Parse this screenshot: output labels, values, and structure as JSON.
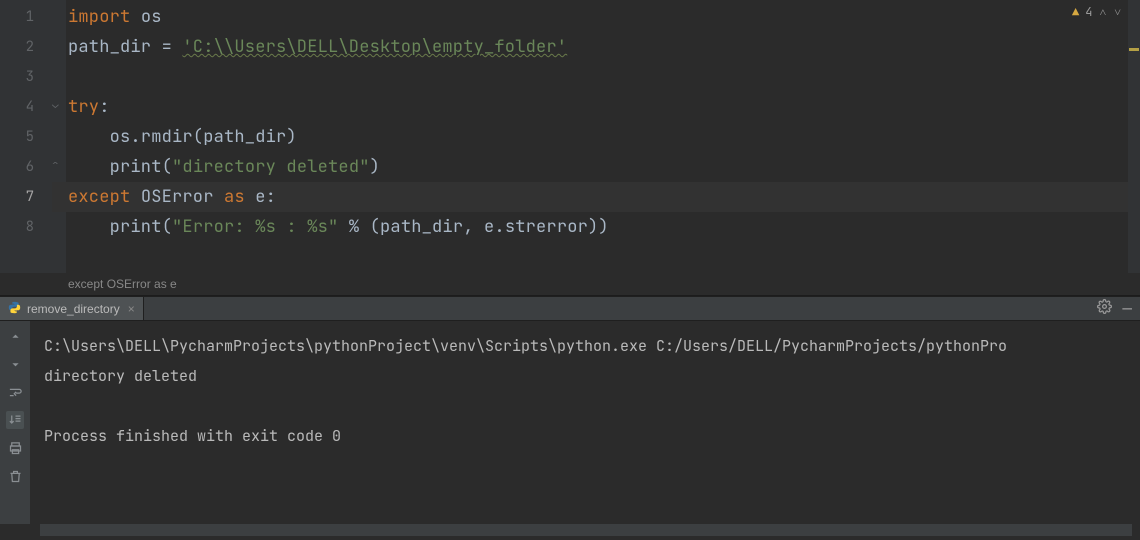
{
  "editor": {
    "lines": {
      "l1": {
        "kw": "import",
        "sp": " ",
        "id": "os"
      },
      "l2_a": "path_dir = ",
      "l2_str": "'C:\\\\Users\\DELL\\Desktop\\empty_folder'",
      "l4_kw": "try",
      "l4_colon": ":",
      "l5": "    os.rmdir(path_dir)",
      "l6_a": "    ",
      "l6_fn": "print",
      "l6_b": "(",
      "l6_str": "\"directory deleted\"",
      "l6_c": ")",
      "l7_ex": "except",
      "l7_sp": " ",
      "l7_err": "OSError",
      "l7_sp2": " ",
      "l7_as": "as",
      "l7_sp3": " ",
      "l7_e": "e",
      "l7_colon": ":",
      "l8_a": "    ",
      "l8_fn": "print",
      "l8_b": "(",
      "l8_str": "\"Error: %s : %s\"",
      "l8_c": " % (path_dir, e.strerror))"
    },
    "line_numbers": [
      "1",
      "2",
      "3",
      "4",
      "5",
      "6",
      "7",
      "8"
    ],
    "current_line_index": 6
  },
  "breadcrumb": {
    "text": "except OSError as e"
  },
  "inspection": {
    "warning_count": "4"
  },
  "run_tab": {
    "label": "remove_directory"
  },
  "terminal": {
    "line1": "C:\\Users\\DELL\\PycharmProjects\\pythonProject\\venv\\Scripts\\python.exe C:/Users/DELL/PycharmProjects/pythonPro",
    "line2": "directory deleted",
    "blank": "",
    "line4": "Process finished with exit code 0"
  },
  "icons": {
    "gear": "settings-icon",
    "hide": "hide-panel-icon",
    "close": "close-icon",
    "python": "python-file-icon"
  }
}
